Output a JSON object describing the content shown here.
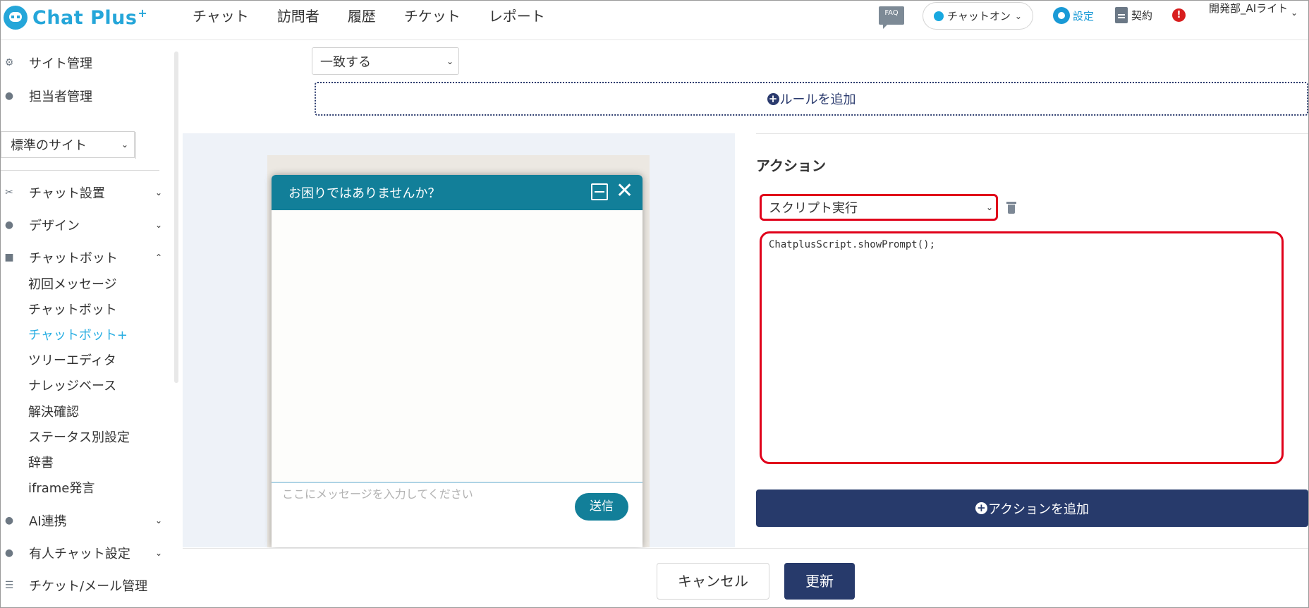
{
  "header": {
    "logo_text": "Chat Plus",
    "logo_sup": "+",
    "nav": [
      "チャット",
      "訪問者",
      "履歴",
      "チケット",
      "レポート"
    ],
    "faq_label": "FAQ",
    "status_label": "チャットオン",
    "settings_label": "設定",
    "contract_label": "契約",
    "alert_label": "!",
    "user_label": "開発部_AIライト"
  },
  "sidebar": {
    "site_manage": "サイト管理",
    "staff_manage": "担当者管理",
    "site_select": "標準のサイト",
    "sections": {
      "chat_setup": "チャット設置",
      "design": "デザイン",
      "chatbot": "チャットボット",
      "ai": "AI連携",
      "live_chat": "有人チャット設定",
      "ticket_mail": "チケット/メール管理"
    },
    "chatbot_sub": [
      "初回メッセージ",
      "チャットボット",
      "チャットボット+",
      "ツリーエディタ",
      "ナレッジベース",
      "解決確認",
      "ステータス別設定",
      "辞書",
      "iframe発言"
    ],
    "active_sub": "チャットボット+"
  },
  "rule": {
    "match_select": "一致する",
    "add_rule_label": "ルールを追加"
  },
  "preview": {
    "title": "お困りではありませんか？",
    "placeholder": "ここにメッセージを入力してください",
    "send_label": "送信"
  },
  "action": {
    "title": "アクション",
    "select_value": "スクリプト実行",
    "script": "ChatplusScript.showPrompt();",
    "add_action_label": "アクションを追加"
  },
  "footer": {
    "cancel_label": "キャンセル",
    "update_label": "更新"
  },
  "colors": {
    "brand": "#25a6d9",
    "navy": "#273a6b",
    "highlight": "#e0001a",
    "chat_teal": "#127f99"
  }
}
